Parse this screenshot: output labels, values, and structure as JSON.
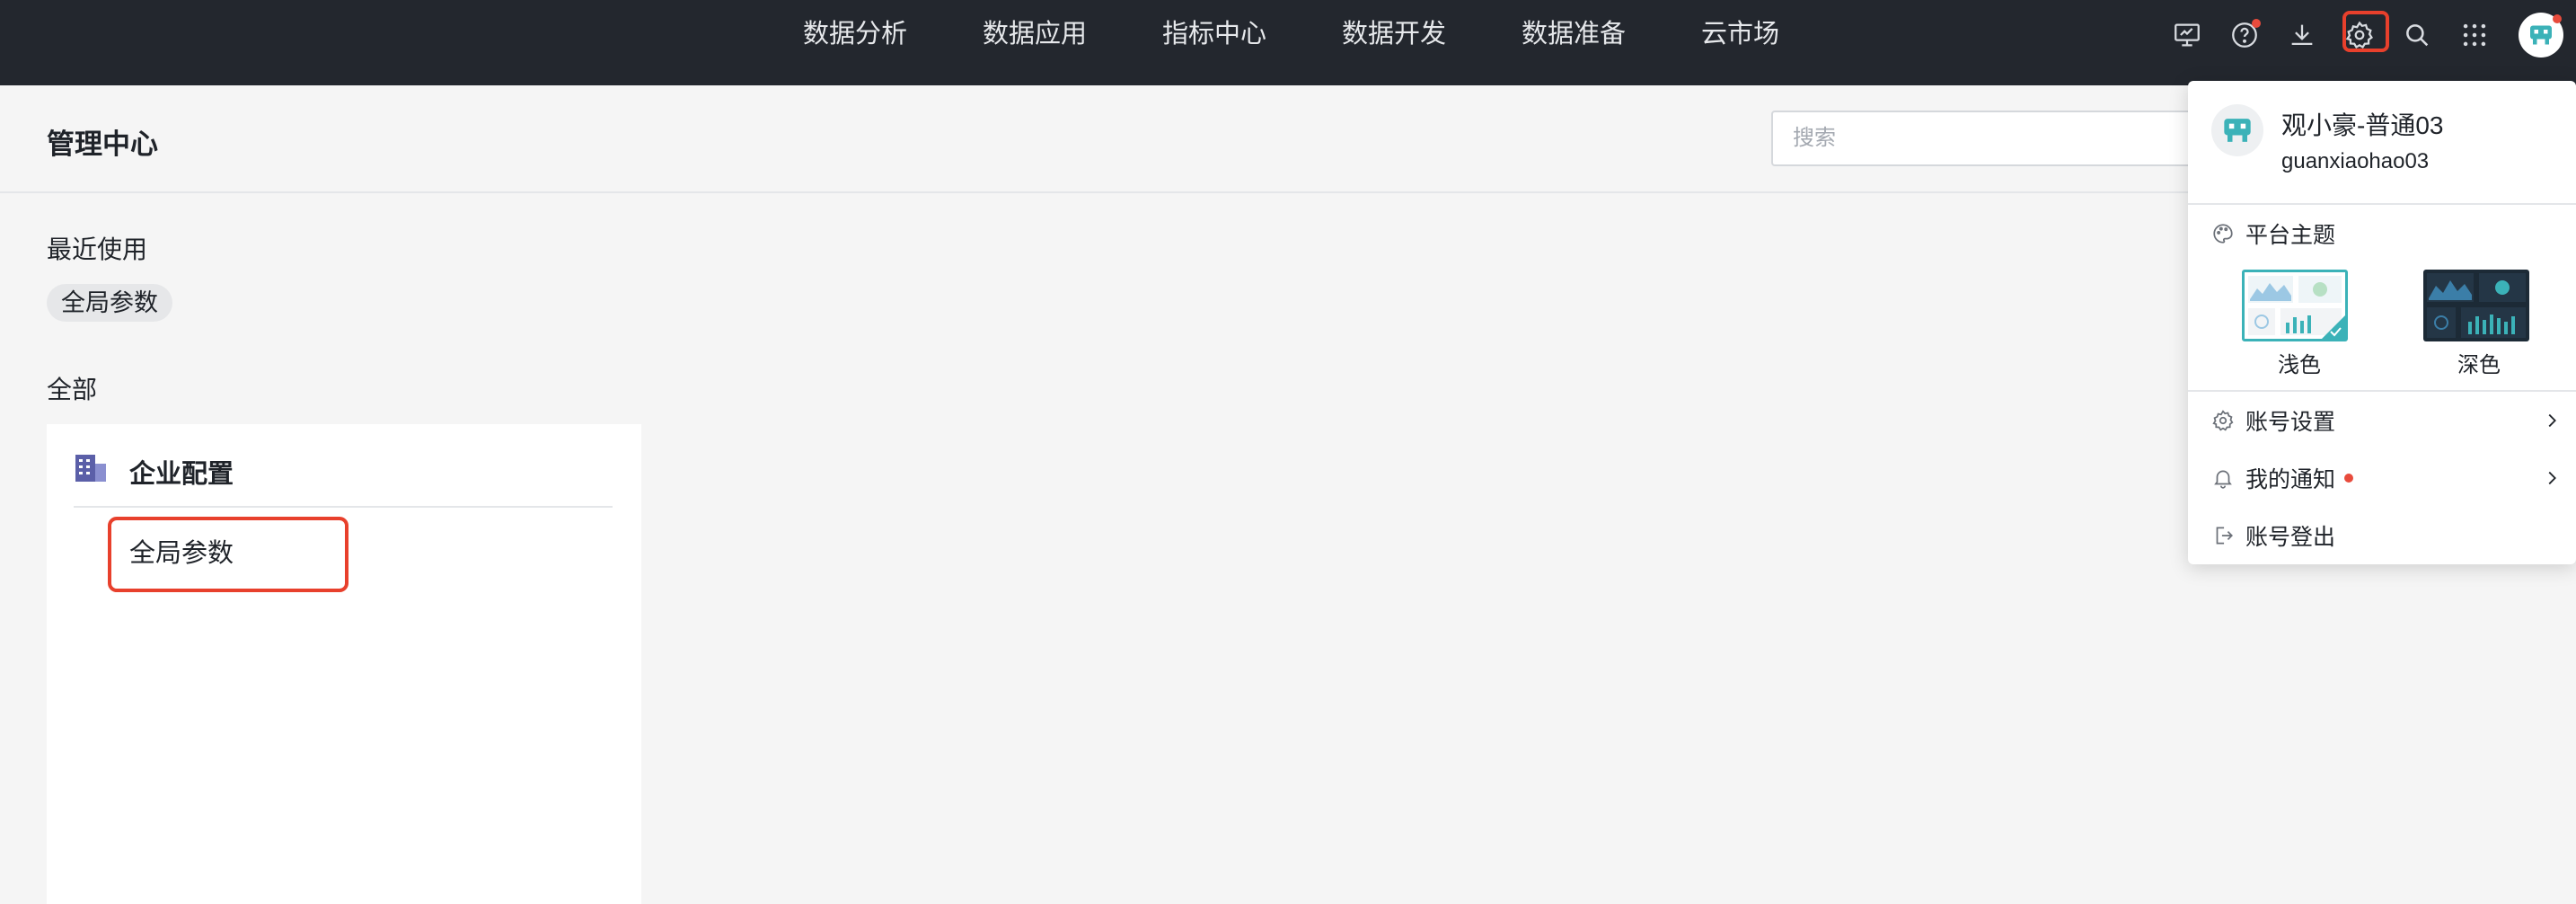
{
  "nav": {
    "items": [
      {
        "label": "数据分析"
      },
      {
        "label": "数据应用"
      },
      {
        "label": "指标中心"
      },
      {
        "label": "数据开发"
      },
      {
        "label": "数据准备"
      },
      {
        "label": "云市场"
      }
    ]
  },
  "toolbar": {
    "icons": [
      "presentation-icon",
      "help-icon",
      "download-icon",
      "gear-icon",
      "search-icon",
      "apps-grid-icon",
      "avatar"
    ]
  },
  "page": {
    "title": "管理中心",
    "search_placeholder": "搜索"
  },
  "recent": {
    "label": "最近使用",
    "chips": [
      "全局参数"
    ]
  },
  "all": {
    "label": "全部",
    "card": {
      "title": "企业配置",
      "items": [
        "全局参数"
      ]
    }
  },
  "user_menu": {
    "name": "观小豪-普通03",
    "id": "guanxiaohao03",
    "theme": {
      "label": "平台主题",
      "options": [
        {
          "label": "浅色",
          "selected": true
        },
        {
          "label": "深色",
          "selected": false
        }
      ]
    },
    "items": {
      "account_settings": "账号设置",
      "notifications": "我的通知",
      "logout": "账号登出"
    }
  },
  "colors": {
    "topbar": "#23272e",
    "highlight": "#e8402c",
    "accent_teal": "#3bb2b8",
    "dot": "#e84b3c"
  }
}
